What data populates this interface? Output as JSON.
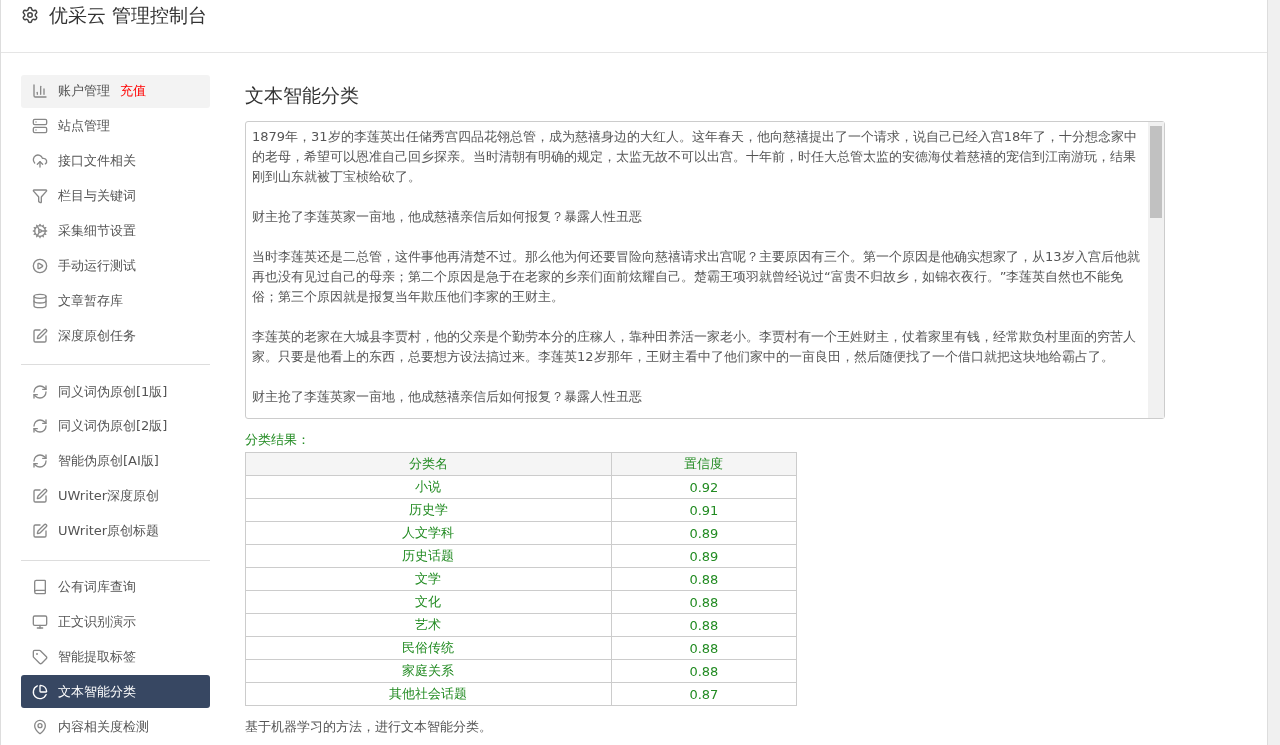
{
  "header": {
    "title": "优采云 管理控制台"
  },
  "sidebar": {
    "groups": [
      {
        "items": [
          {
            "label": "账户管理",
            "badge": "充值",
            "selected": false
          },
          {
            "label": "站点管理",
            "selected": false
          },
          {
            "label": "接口文件相关",
            "selected": false
          },
          {
            "label": "栏目与关键词",
            "selected": false
          },
          {
            "label": "采集细节设置",
            "selected": false
          },
          {
            "label": "手动运行测试",
            "selected": false
          },
          {
            "label": "文章暂存库",
            "selected": false
          },
          {
            "label": "深度原创任务",
            "selected": false
          }
        ]
      },
      {
        "items": [
          {
            "label": "同义词伪原创[1版]",
            "selected": false
          },
          {
            "label": "同义词伪原创[2版]",
            "selected": false
          },
          {
            "label": "智能伪原创[AI版]",
            "selected": false
          },
          {
            "label": "UWriter深度原创",
            "selected": false
          },
          {
            "label": "UWriter原创标题",
            "selected": false
          }
        ]
      },
      {
        "items": [
          {
            "label": "公有词库查询",
            "selected": false
          },
          {
            "label": "正文识别演示",
            "selected": false
          },
          {
            "label": "智能提取标签",
            "selected": false
          },
          {
            "label": "文本智能分类",
            "selected": true
          },
          {
            "label": "内容相关度检测",
            "selected": false
          }
        ]
      }
    ]
  },
  "main": {
    "title": "文本智能分类",
    "article": [
      "1879年，31岁的李莲英出任储秀宫四品花翎总管，成为慈禧身边的大红人。这年春天，他向慈禧提出了一个请求，说自己已经入宫18年了，十分想念家中的老母，希望可以恩准自己回乡探亲。当时清朝有明确的规定，太监无故不可以出宫。十年前，时任大总管太监的安德海仗着慈禧的宠信到江南游玩，结果刚到山东就被丁宝桢给砍了。",
      "财主抢了李莲英家一亩地，他成慈禧亲信后如何报复？暴露人性丑恶",
      "当时李莲英还是二总管，这件事他再清楚不过。那么他为何还要冒险向慈禧请求出宫呢？主要原因有三个。第一个原因是他确实想家了，从13岁入宫后他就再也没有见过自己的母亲；第二个原因是急于在老家的乡亲们面前炫耀自己。楚霸王项羽就曾经说过“富贵不归故乡，如锦衣夜行。”李莲英自然也不能免俗；第三个原因就是报复当年欺压他们李家的王财主。",
      "李莲英的老家在大城县李贾村，他的父亲是个勤劳本分的庄稼人，靠种田养活一家老小。李贾村有一个王姓财主，仗着家里有钱，经常欺负村里面的穷苦人家。只要是他看上的东西，总要想方设法搞过来。李莲英12岁那年，王财主看中了他们家中的一亩良田，然后随便找了一个借口就把这块地给霸占了。",
      "财主抢了李莲英家一亩地，他成慈禧亲信后如何报复？暴露人性丑恶"
    ],
    "result_label": "分类结果：",
    "table": {
      "columns": [
        "分类名",
        "置信度"
      ],
      "rows": [
        [
          "小说",
          "0.92"
        ],
        [
          "历史学",
          "0.91"
        ],
        [
          "人文学科",
          "0.89"
        ],
        [
          "历史话题",
          "0.89"
        ],
        [
          "文学",
          "0.88"
        ],
        [
          "文化",
          "0.88"
        ],
        [
          "艺术",
          "0.88"
        ],
        [
          "民俗传统",
          "0.88"
        ],
        [
          "家庭关系",
          "0.88"
        ],
        [
          "其他社会话题",
          "0.87"
        ]
      ]
    },
    "note": "基于机器学习的方法，进行文本智能分类。"
  }
}
